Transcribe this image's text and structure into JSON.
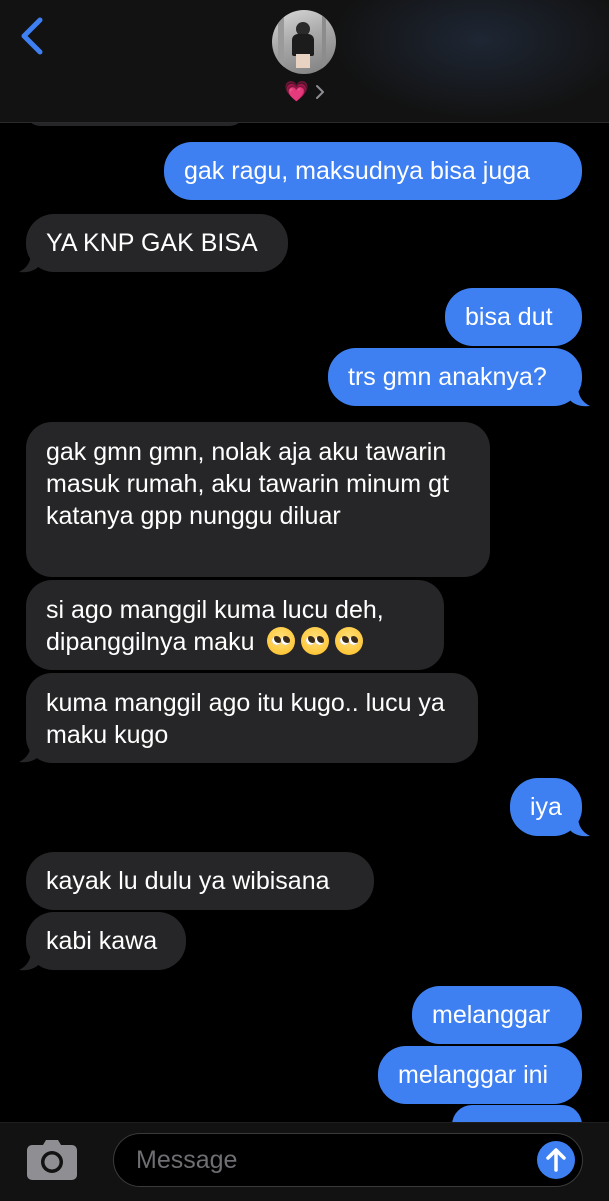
{
  "header": {
    "back_icon": "chevron-left-icon",
    "contact_emoji": "💗",
    "accent": "#3e80f2"
  },
  "messages": [
    {
      "dir": "out",
      "text": "gak ragu, maksudnya bisa juga"
    },
    {
      "dir": "in",
      "text": "YA KNP GAK BISA"
    },
    {
      "dir": "out",
      "text": "bisa dut"
    },
    {
      "dir": "out",
      "text": "trs gmn anaknya?"
    },
    {
      "dir": "in",
      "text": "gak gmn gmn, nolak aja aku tawarin masuk rumah, aku tawarin minum gt katanya gpp nunggu diluar"
    },
    {
      "dir": "in",
      "text": "si ago manggil kuma lucu deh, dipanggilnya maku"
    },
    {
      "dir": "in",
      "text": "kuma manggil ago itu kugo.. lucu ya maku kugo"
    },
    {
      "dir": "out",
      "text": "iya"
    },
    {
      "dir": "in",
      "text": "kayak lu dulu ya wibisana"
    },
    {
      "dir": "in",
      "text": "kabi kawa"
    },
    {
      "dir": "out",
      "text": "melanggar"
    },
    {
      "dir": "out",
      "text": "melanggar ini"
    }
  ],
  "composer": {
    "placeholder": "Message",
    "camera_icon": "camera-icon",
    "send_icon": "arrow-up-icon"
  },
  "colors": {
    "background": "#000000",
    "incoming_bubble": "#262628",
    "outgoing_bubble": "#3e80f2",
    "bar": "#121212"
  }
}
